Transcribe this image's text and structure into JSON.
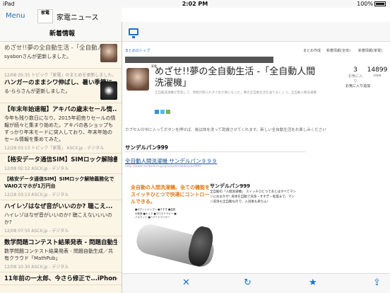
{
  "status": {
    "carrier": "iPad",
    "time": "2:02 PM",
    "battery": "100%"
  },
  "left": {
    "menu": "Menu",
    "logo_text": "家電",
    "app_title": "家電ニュース",
    "section_title": "新着情報",
    "items": [
      {
        "title": "めざせ!!夢の全自動生活 ‐「全自動人",
        "body": "syabonさんが更新しました。",
        "meta": "",
        "thumb": "person"
      },
      {
        "title": "ハンガーのままシワ伸ばし、暑い季節に...",
        "body": "る-ららさんが更新しました。",
        "meta": "12/08 05:35 トピック「家電」のまとめを更新しました。",
        "thumb": "dark"
      },
      {
        "title": "【年末年始速報】アキバの歳末セール情...",
        "body": "今年も残り数日になり、2015年初売りセールの情報が続々と集まり始めた。アキバの各ショップもすっかり年末モードに突入しており、年末年始のセール情報を集めてみた。",
        "meta": "12/28 03:13 トピック「家電」 ASCII.jp ‐ デジタル",
        "thumb": ""
      },
      {
        "title": "【格安データ通信SIM】SIMロック解除義...",
        "body": "",
        "meta": "12/08 02:12 ASCII.jp ‐ デジタル",
        "thumb": ""
      },
      {
        "title": "【格安データ通信SIM】SIMロック解除義務化でVAIOスマホが1万円台",
        "body": "",
        "meta": "12/28 03:13 ASCII.jp ‐ デジタル",
        "thumb": ""
      },
      {
        "title": "ハイレゾはなぜ音がいいのか? 聴こえ...",
        "body": "ハイレゾはなぜ音がいいのか? 聴こえないいいのか?",
        "meta": "12/08 07:50 ASCII.jp ‐ デジタル",
        "thumb": ""
      },
      {
        "title": "数学問題コンテスト結果発表 ‐ 問題自動生...",
        "body": "数学問題コンテスト結果発表 ‐ 問題自動生成／共有クラウド「MathPub」",
        "meta": "12/08 10:30 ASCII.jp ‐ デジタル",
        "thumb": ""
      },
      {
        "title": "11年前の一太郎、今さら修正で...iPhone 6のタ...",
        "body": "",
        "meta": "",
        "thumb": ""
      }
    ]
  },
  "article": {
    "site": "まとめのトップ",
    "nav": [
      "まとめのトップ",
      "家電",
      "家電・AV機器",
      "生活家電"
    ],
    "top_links": [
      "まとめ作成",
      "新着情報(全体)",
      "新着情報(家電)"
    ],
    "title": "めざせ!!夢の全自動生活 ‐「全自動人間洗濯機」",
    "stat1": {
      "num": "3",
      "label": "お気に入り"
    },
    "stat2": {
      "num": "14899",
      "label": "view"
    },
    "add_list": "お気に入り追加",
    "description": "全自動洗濯機が普及して、時間が取られず人生が楽になった。夢の全自動生活を送りましょう。全自動人間洗濯機",
    "lead": "カプセルの中に入ってボタンを押せば、後は体を洗って乾燥させてくれます。新しい全自動生活をお楽しみください",
    "section": "サンデルパン999",
    "link": "全自動人間洗濯機 サンデルパン９９９",
    "url": "http://www.sunbell.co.jp/product/sanderpan999",
    "ad_headline": "全自動の人間洗濯機。全ての機能をスイッチひとつで快適にコントロールできる。",
    "ad_list": "■ボディシャンプー ■すすぎ ■温風の乾燥 ■キュア ■アロマテラピー ■バスマット ■ヘアードライヤー",
    "product_title": "サンデルパン999",
    "product_desc": "全自動の「人間洗濯機」 スイッチひとつであとはすべてマシンにおまかせ! 身体を自動で洗浄・すすぎ・乾燥まで。マシン洗浄も全自動なので、入浴後も楽ちん!"
  },
  "toolbar": {
    "close": "✕",
    "reload": "↻",
    "star": "★",
    "share": "⇪"
  }
}
